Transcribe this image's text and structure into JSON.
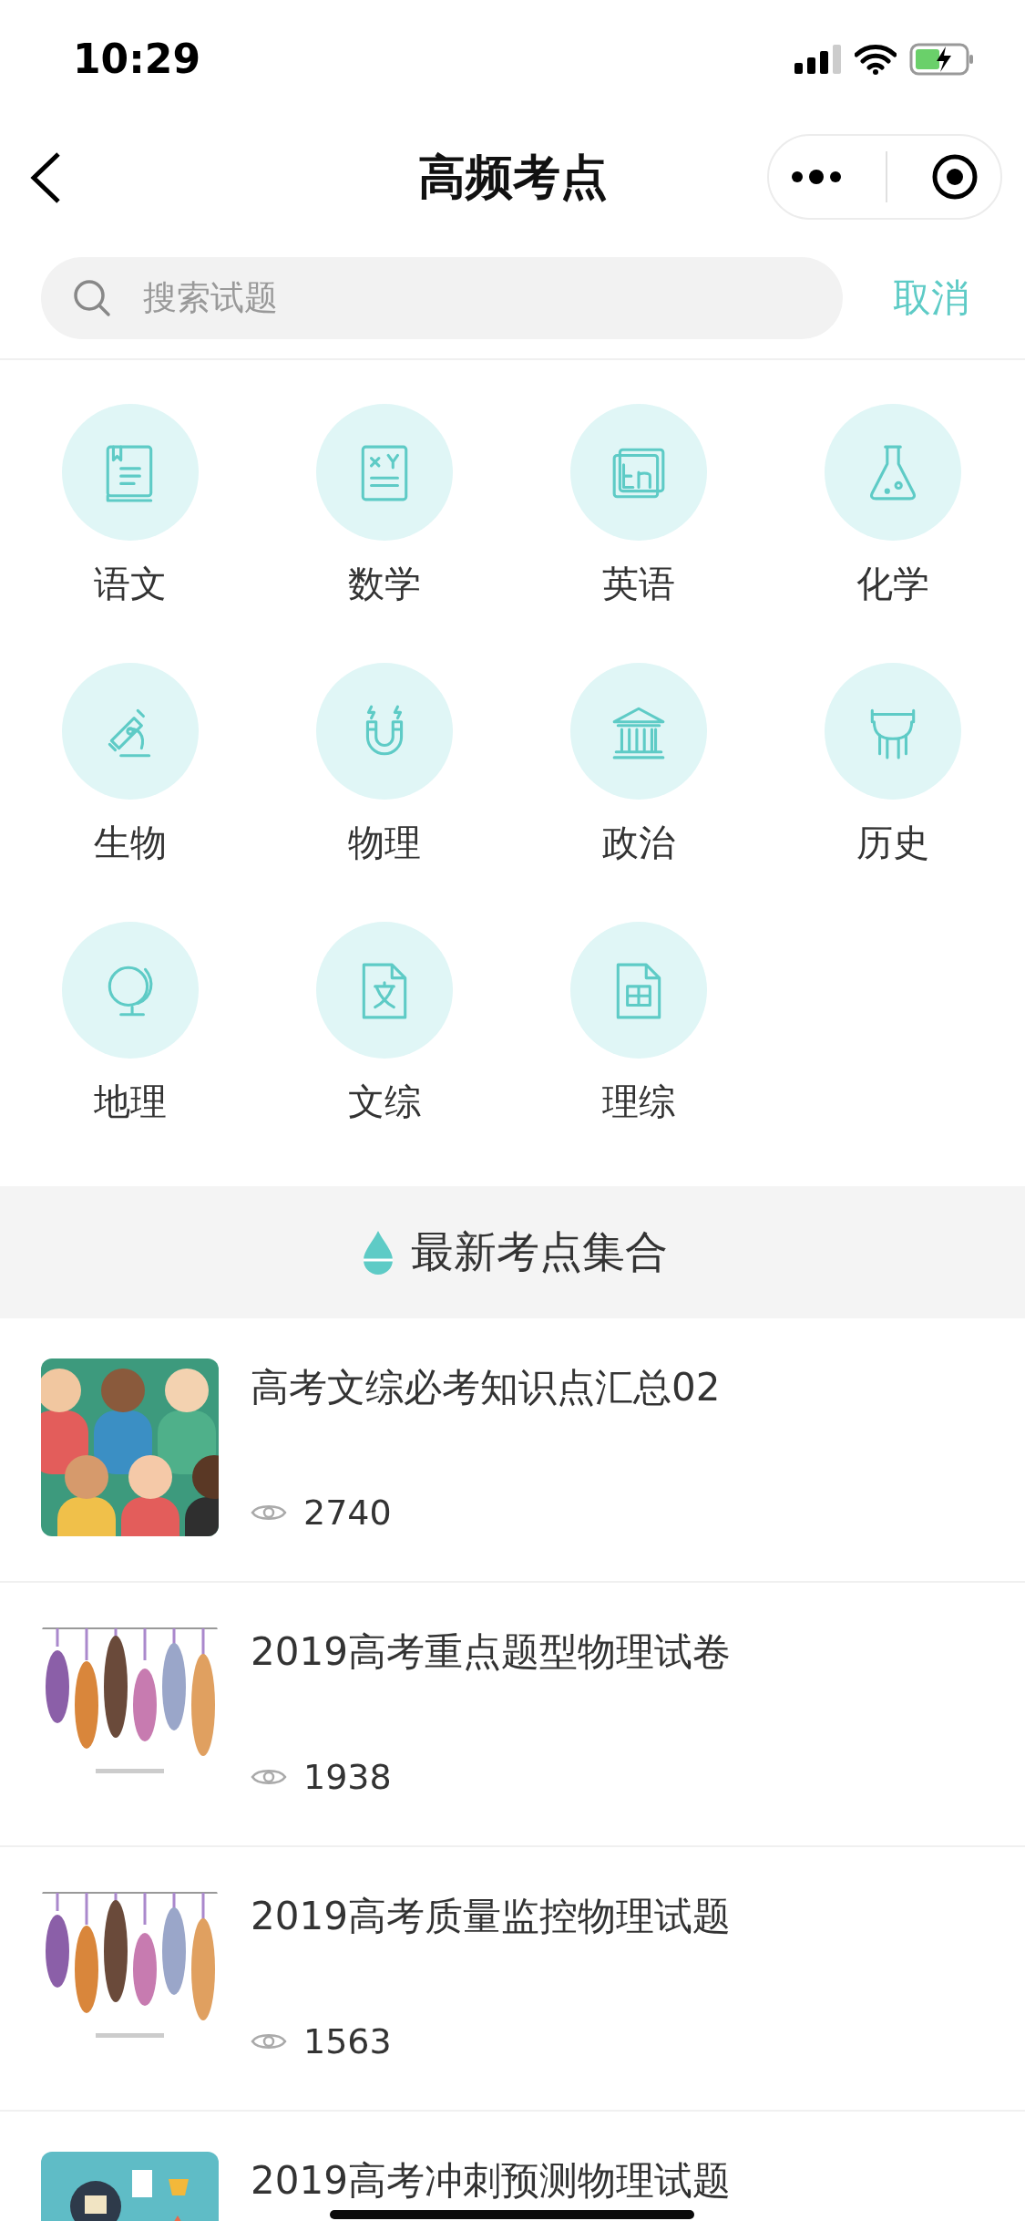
{
  "status_bar": {
    "time": "10:29"
  },
  "nav": {
    "title": "高频考点"
  },
  "search": {
    "placeholder": "搜索试题",
    "cancel": "取消"
  },
  "subjects": [
    {
      "label": "语文"
    },
    {
      "label": "数学"
    },
    {
      "label": "英语"
    },
    {
      "label": "化学"
    },
    {
      "label": "生物"
    },
    {
      "label": "物理"
    },
    {
      "label": "政治"
    },
    {
      "label": "历史"
    },
    {
      "label": "地理"
    },
    {
      "label": "文综"
    },
    {
      "label": "理综"
    }
  ],
  "section": {
    "title": "最新考点集合"
  },
  "articles": [
    {
      "title": "高考文综必考知识点汇总02",
      "views": "2740"
    },
    {
      "title": "2019高考重点题型物理试卷",
      "views": "1938"
    },
    {
      "title": "2019高考质量监控物理试题",
      "views": "1563"
    },
    {
      "title": "2019高考冲刺预测物理试题"
    }
  ]
}
